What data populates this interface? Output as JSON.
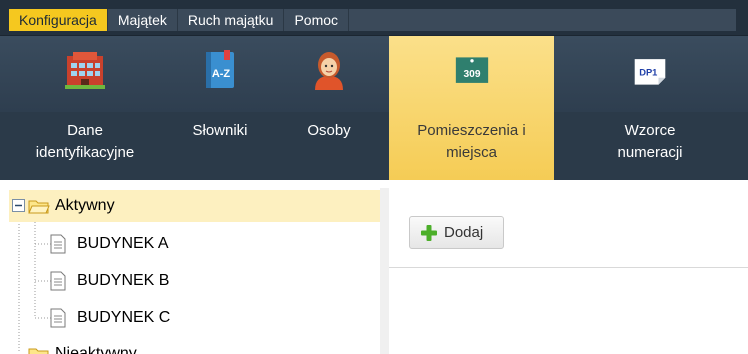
{
  "menu": {
    "items": [
      {
        "label": "Konfiguracja"
      },
      {
        "label": "Majątek"
      },
      {
        "label": "Ruch majątku"
      },
      {
        "label": "Pomoc"
      }
    ]
  },
  "ribbon": {
    "buttons": [
      {
        "line1": "Dane",
        "line2": "identyfikacyjne",
        "icon": "building-icon"
      },
      {
        "line1": "Słowniki",
        "line2": "",
        "icon": "dictionary-icon"
      },
      {
        "line1": "Osoby",
        "line2": "",
        "icon": "person-icon"
      },
      {
        "line1": "Pomieszczenia i",
        "line2": "miejsca",
        "icon": "room-number-icon",
        "icon_text": "309"
      },
      {
        "line1": "Wzorce",
        "line2": "numeracji",
        "icon": "numbering-template-icon",
        "icon_text": "DP1"
      }
    ]
  },
  "tree": {
    "root_active": "Aktywny",
    "children": [
      "BUDYNEK A",
      "BUDYNEK B",
      "BUDYNEK C"
    ],
    "root_inactive": "Nieaktywny"
  },
  "toolbar": {
    "add_label": "Dodaj"
  },
  "colors": {
    "accent": "#f5c81f",
    "menubar": "#23303d",
    "ribbon": "#2b3a49",
    "selection": "#fdf0c0"
  }
}
